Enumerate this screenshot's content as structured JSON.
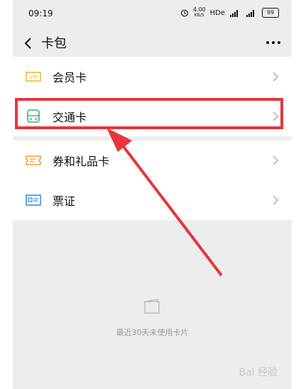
{
  "statusbar": {
    "time": "09:19",
    "speed_value": "4.00",
    "speed_unit": "KB/S",
    "hd_label": "HDe",
    "battery": "99"
  },
  "navbar": {
    "title": "卡包"
  },
  "items": [
    {
      "label": "会员卡",
      "icon": "vip-card-icon",
      "color": "#f2b12b"
    },
    {
      "label": "交通卡",
      "icon": "bus-card-icon",
      "color": "#35b36d"
    },
    {
      "label": "券和礼品卡",
      "icon": "coupon-icon",
      "color": "#f0a03a"
    },
    {
      "label": "票证",
      "icon": "id-card-icon",
      "color": "#2f86e0"
    }
  ],
  "empty": {
    "text": "最近30天未使用卡片"
  },
  "watermark": "Bai 经验"
}
